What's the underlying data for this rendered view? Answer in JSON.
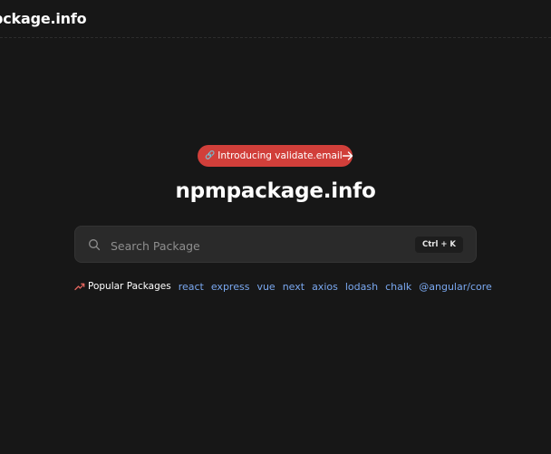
{
  "header": {
    "logo_text": "pckage.info"
  },
  "announcement": {
    "icon": "link-icon",
    "label": "Introducing validate.email",
    "arrow_icon": "arrow-right-icon"
  },
  "hero": {
    "title": "npmpackage.info"
  },
  "search": {
    "icon": "search-icon",
    "placeholder": "Search Package",
    "value": "",
    "shortcut": "Ctrl + K"
  },
  "popular": {
    "icon": "trending-up-icon",
    "label": "Popular Packages",
    "packages": [
      "react",
      "express",
      "vue",
      "next",
      "axios",
      "lodash",
      "chalk",
      "@angular/core"
    ]
  },
  "colors": {
    "background": "#171717",
    "accent": "#d13f3a",
    "link": "#7aa8f0",
    "search_bg": "#2a2a2a"
  }
}
